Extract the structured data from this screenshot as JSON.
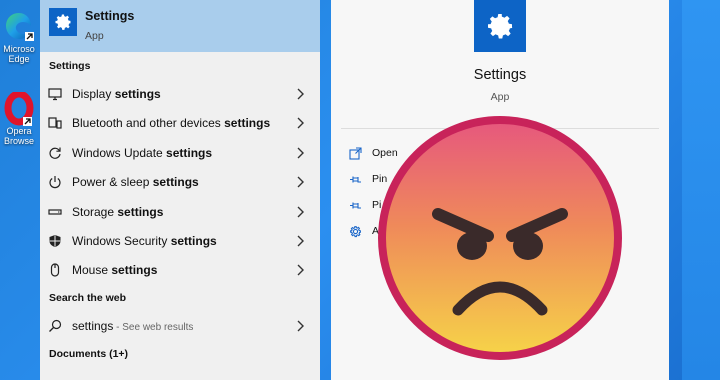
{
  "desktop": {
    "icons": [
      {
        "name": "Microsoft Edge",
        "label": "Microso\nEdge"
      },
      {
        "name": "Opera Browser",
        "label": "Opera\nBrowse"
      }
    ]
  },
  "search": {
    "best_match": {
      "title": "Settings",
      "subtitle": "App",
      "icon": "gear-icon"
    },
    "settings_header": "Settings",
    "results": [
      {
        "icon": "monitor-icon",
        "prefix": "Display ",
        "bold": "settings"
      },
      {
        "icon": "bluetooth-devices-icon",
        "prefix": "Bluetooth and other devices ",
        "bold": "settings"
      },
      {
        "icon": "refresh-icon",
        "prefix": "Windows Update ",
        "bold": "settings"
      },
      {
        "icon": "power-icon",
        "prefix": "Power & sleep ",
        "bold": "settings"
      },
      {
        "icon": "storage-drive-icon",
        "prefix": "Storage ",
        "bold": "settings"
      },
      {
        "icon": "shield-icon",
        "prefix": "Windows Security ",
        "bold": "settings"
      },
      {
        "icon": "mouse-icon",
        "prefix": "Mouse ",
        "bold": "settings"
      }
    ],
    "web_header": "Search the web",
    "web_result": {
      "query": "settings",
      "suffix": " - See web results",
      "icon": "search-icon"
    },
    "documents_header": "Documents (1+)"
  },
  "preview": {
    "title": "Settings",
    "subtitle": "App",
    "actions": [
      {
        "icon": "open-icon",
        "label": "Open"
      },
      {
        "icon": "pin-icon",
        "label": "Pin"
      },
      {
        "icon": "pin-icon",
        "label": "Pi"
      },
      {
        "icon": "gear-icon",
        "label": "A"
      }
    ]
  },
  "overlay": {
    "emoji": "angry-face-emoji"
  },
  "colors": {
    "accent": "#0d64c6",
    "selected_row": "#a9cdec",
    "panel_bg": "#f0f0f0",
    "desktop_blue": "#1f7fd8",
    "emoji_top": "#e85a7a",
    "emoji_bottom": "#f5d24a",
    "emoji_border": "#c8235a"
  }
}
